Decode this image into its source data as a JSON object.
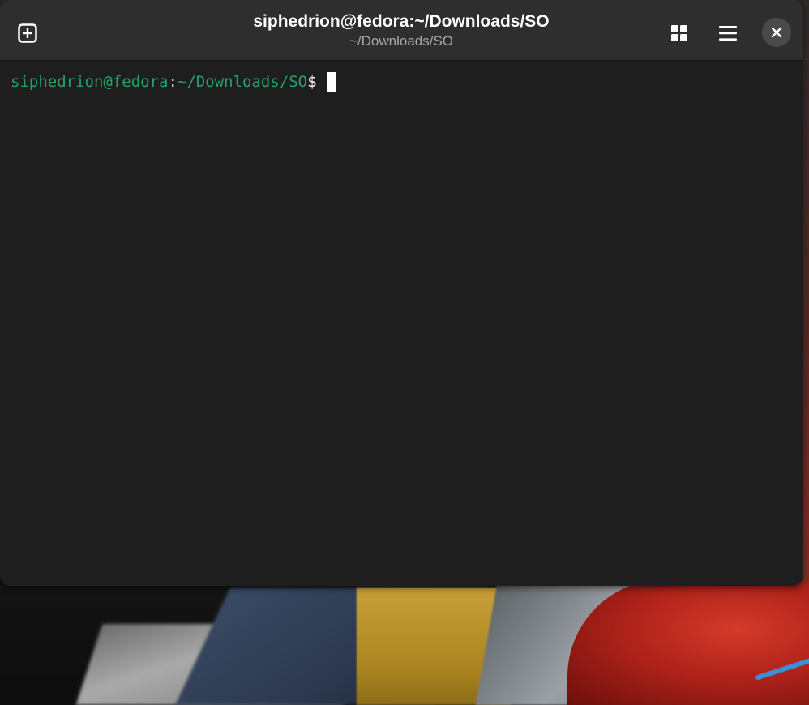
{
  "window": {
    "title": "siphedrion@fedora:~/Downloads/SO",
    "subtitle": "~/Downloads/SO"
  },
  "headerbar": {
    "buttons": [
      {
        "name": "new-tab-button",
        "icon": "tab-new-icon"
      },
      {
        "name": "tab-overview-button",
        "icon": "view-grid-icon"
      },
      {
        "name": "main-menu-button",
        "icon": "open-menu-icon"
      },
      {
        "name": "close-button",
        "icon": "close-icon"
      }
    ]
  },
  "terminal": {
    "prompt_user_host": "siphedrion@fedora",
    "prompt_colon": ":",
    "prompt_path": "~/Downloads/SO",
    "prompt_symbol": "$",
    "input": ""
  },
  "colors": {
    "prompt_green": "#26a269",
    "terminal_bg": "#1e1e1e",
    "headerbar_bg": "#2e2e2e"
  }
}
